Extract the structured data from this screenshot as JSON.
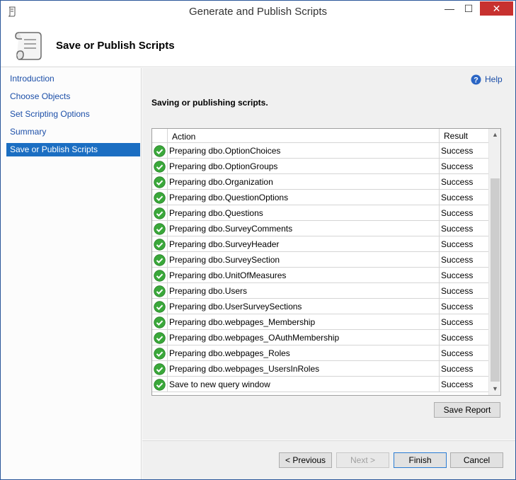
{
  "window": {
    "title": "Generate and Publish Scripts",
    "minimize_glyph": "—",
    "maximize_glyph": "☐",
    "close_glyph": "✕"
  },
  "header": {
    "title": "Save or Publish Scripts"
  },
  "sidebar": {
    "items": [
      {
        "label": "Introduction"
      },
      {
        "label": "Choose Objects"
      },
      {
        "label": "Set Scripting Options"
      },
      {
        "label": "Summary"
      },
      {
        "label": "Save or Publish Scripts"
      }
    ]
  },
  "help": {
    "label": "Help"
  },
  "main": {
    "section_title": "Saving or publishing scripts."
  },
  "grid": {
    "columns": {
      "action": "Action",
      "result": "Result"
    },
    "rows": [
      {
        "action": "Preparing dbo.OptionChoices",
        "result": "Success"
      },
      {
        "action": "Preparing dbo.OptionGroups",
        "result": "Success"
      },
      {
        "action": "Preparing dbo.Organization",
        "result": "Success"
      },
      {
        "action": "Preparing dbo.QuestionOptions",
        "result": "Success"
      },
      {
        "action": "Preparing dbo.Questions",
        "result": "Success"
      },
      {
        "action": "Preparing dbo.SurveyComments",
        "result": "Success"
      },
      {
        "action": "Preparing dbo.SurveyHeader",
        "result": "Success"
      },
      {
        "action": "Preparing dbo.SurveySection",
        "result": "Success"
      },
      {
        "action": "Preparing dbo.UnitOfMeasures",
        "result": "Success"
      },
      {
        "action": "Preparing dbo.Users",
        "result": "Success"
      },
      {
        "action": "Preparing dbo.UserSurveySections",
        "result": "Success"
      },
      {
        "action": "Preparing dbo.webpages_Membership",
        "result": "Success"
      },
      {
        "action": "Preparing dbo.webpages_OAuthMembership",
        "result": "Success"
      },
      {
        "action": "Preparing dbo.webpages_Roles",
        "result": "Success"
      },
      {
        "action": "Preparing dbo.webpages_UsersInRoles",
        "result": "Success"
      },
      {
        "action": "Save to new query window",
        "result": "Success"
      }
    ]
  },
  "buttons": {
    "save_report": "Save Report",
    "previous": "< Previous",
    "next": "Next >",
    "finish": "Finish",
    "cancel": "Cancel"
  },
  "colors": {
    "accent": "#1b6ec2",
    "link": "#1c4fa8",
    "success": "#3aa83a",
    "close": "#c7312f"
  }
}
